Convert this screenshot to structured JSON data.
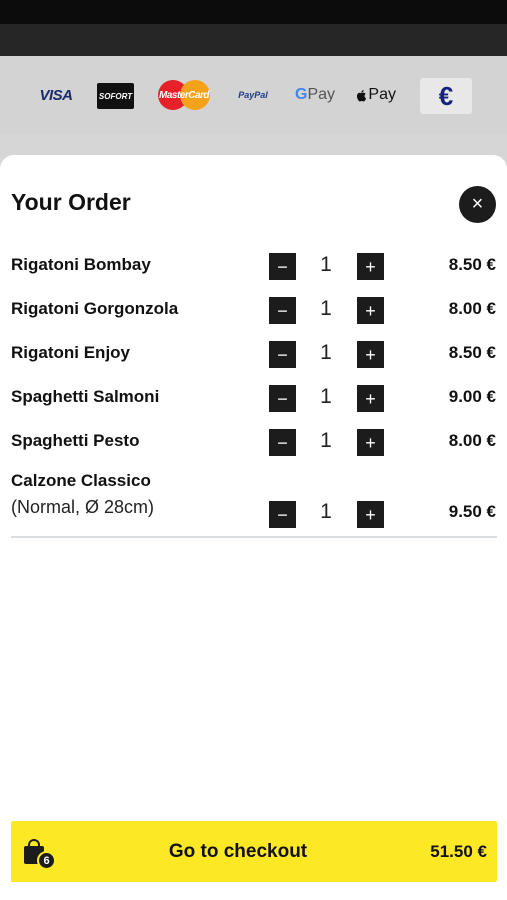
{
  "payment_methods": {
    "visa": "VISA",
    "sofort": "SOFORT",
    "mastercard": "MasterCard",
    "paypal": "PayPal",
    "gpay_g": "G",
    "gpay_text": "Pay",
    "applepay": "Pay",
    "currency": "€"
  },
  "order": {
    "title": "Your Order",
    "close_icon": "×",
    "minus_symbol": "−",
    "plus_symbol": "+",
    "items": [
      {
        "name": "Rigatoni Bombay",
        "detail": "",
        "qty": "1",
        "price": "8.50 €"
      },
      {
        "name": "Rigatoni Gorgonzola",
        "detail": "",
        "qty": "1",
        "price": "8.00 €"
      },
      {
        "name": "Rigatoni Enjoy",
        "detail": "",
        "qty": "1",
        "price": "8.50 €"
      },
      {
        "name": "Spaghetti Salmoni",
        "detail": "",
        "qty": "1",
        "price": "9.00 €"
      },
      {
        "name": "Spaghetti Pesto",
        "detail": "",
        "qty": "1",
        "price": "8.00 €"
      },
      {
        "name": "Calzone Classico",
        "detail": "(Normal, Ø 28cm)",
        "qty": "1",
        "price": "9.50 €"
      }
    ]
  },
  "checkout": {
    "label": "Go to checkout",
    "total": "51.50 €",
    "cart_count": "6"
  },
  "colors": {
    "checkout_bg": "#fde826",
    "button_dark": "#1c1c1c"
  }
}
